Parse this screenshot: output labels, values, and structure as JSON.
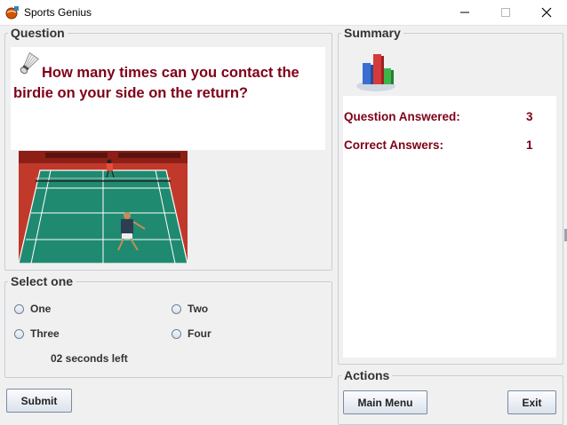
{
  "window": {
    "title": "Sports Genius",
    "controls": [
      "minimize",
      "maximize",
      "close"
    ]
  },
  "question_panel": {
    "legend": "Question",
    "icon": "shuttlecock-icon",
    "question_line1": "How many times can you contact the",
    "question_line2": "birdie on your side on the return?",
    "image": "badminton-court-photo"
  },
  "select_panel": {
    "legend": "Select one",
    "options": [
      "One",
      "Two",
      "Three",
      "Four"
    ],
    "selected": null,
    "timer": "02 seconds left"
  },
  "submit_button": "Submit",
  "summary_panel": {
    "legend": "Summary",
    "icon": "bar-chart-icon",
    "answered_label": "Question Answered:",
    "answered_value": "3",
    "correct_label": "Correct Answers:",
    "correct_value": "1"
  },
  "actions_panel": {
    "legend": "Actions",
    "main_menu": "Main Menu",
    "exit": "Exit"
  },
  "colors": {
    "accent_text": "#7f0018",
    "background": "#f0f0f0"
  }
}
